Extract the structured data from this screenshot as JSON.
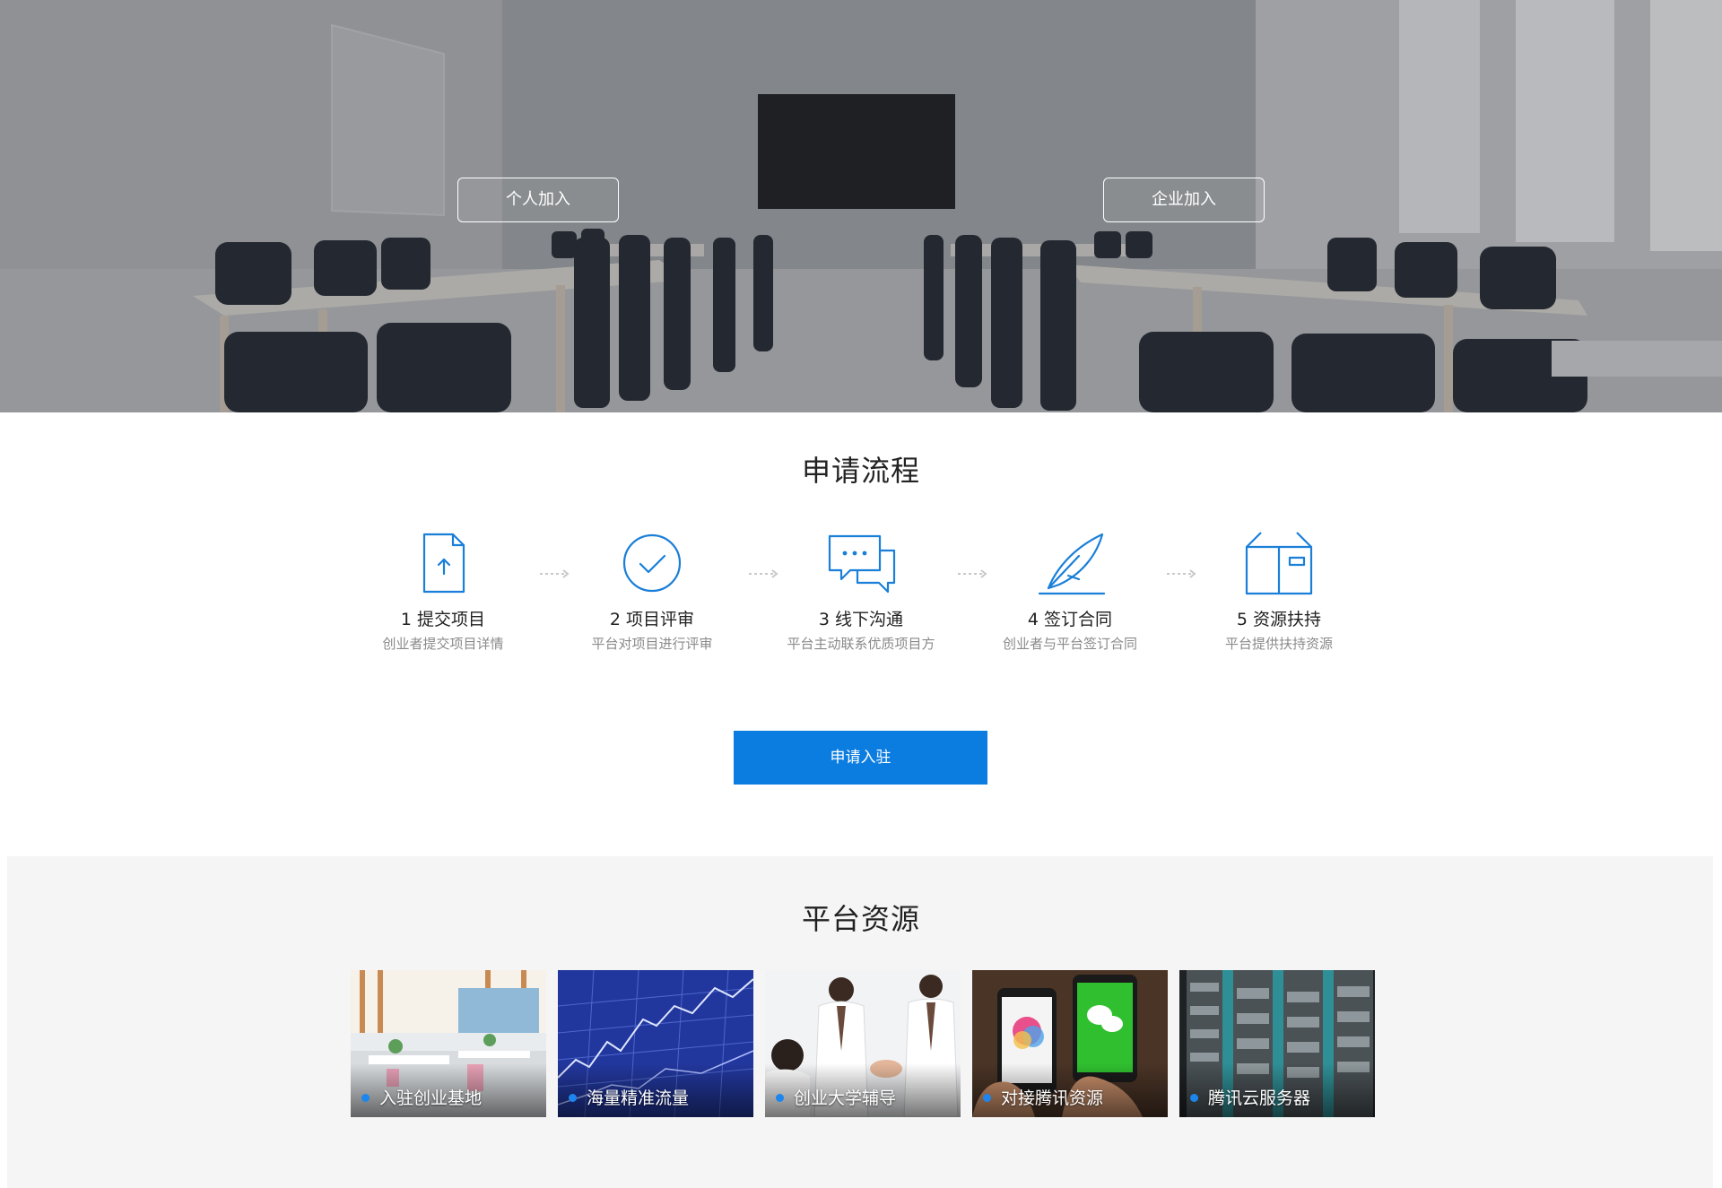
{
  "hero": {
    "personal_join": "个人加入",
    "enterprise_join": "企业加入"
  },
  "process": {
    "title": "申请流程",
    "steps": [
      {
        "title": "1 提交项目",
        "desc": "创业者提交项目详情",
        "icon": "upload-document-icon"
      },
      {
        "title": "2 项目评审",
        "desc": "平台对项目进行评审",
        "icon": "check-circle-icon"
      },
      {
        "title": "3 线下沟通",
        "desc": "平台主动联系优质项目方",
        "icon": "chat-bubbles-icon"
      },
      {
        "title": "4 签订合同",
        "desc": "创业者与平台签订合同",
        "icon": "quill-pen-icon"
      },
      {
        "title": "5 资源扶持",
        "desc": "平台提供扶持资源",
        "icon": "box-icon"
      }
    ],
    "apply_button": "申请入驻"
  },
  "resources": {
    "title": "平台资源",
    "cards": [
      {
        "label": "入驻创业基地"
      },
      {
        "label": "海量精准流量"
      },
      {
        "label": "创业大学辅导"
      },
      {
        "label": "对接腾讯资源"
      },
      {
        "label": "腾讯云服务器"
      }
    ]
  },
  "colors": {
    "accent": "#0c7de0",
    "icon_blue": "#1a7fd8",
    "resources_bg": "#f5f5f5"
  }
}
